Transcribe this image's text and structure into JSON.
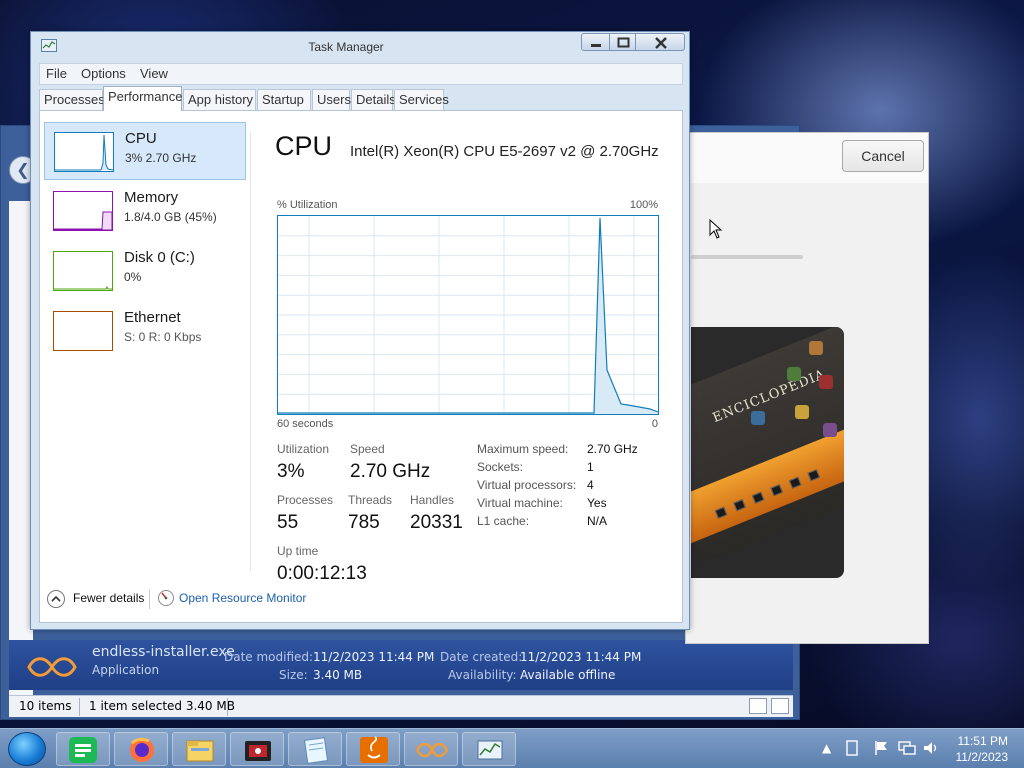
{
  "taskmanager": {
    "title": "Task Manager",
    "menu": [
      "File",
      "Options",
      "View"
    ],
    "tabs": [
      "Processes",
      "Performance",
      "App history",
      "Startup",
      "Users",
      "Details",
      "Services"
    ],
    "active_tab": "Performance",
    "sidebar": [
      {
        "name": "CPU",
        "sub": "3% 2.70 GHz",
        "color": "#117dbb",
        "selected": true
      },
      {
        "name": "Memory",
        "sub": "1.8/4.0 GB (45%)",
        "color": "#8b12ae",
        "selected": false
      },
      {
        "name": "Disk 0 (C:)",
        "sub": "0%",
        "color": "#4da60c",
        "selected": false
      },
      {
        "name": "Ethernet",
        "sub": "S: 0 R: 0 Kbps",
        "color": "#a74f01",
        "selected": false
      }
    ],
    "cpu": {
      "title": "CPU",
      "model": "Intel(R) Xeon(R) CPU E5-2697 v2 @ 2.70GHz",
      "graph_label": "% Utilization",
      "graph_max": "100%",
      "axis_left": "60 seconds",
      "axis_right": "0",
      "stats": {
        "utilization_label": "Utilization",
        "utilization": "3%",
        "speed_label": "Speed",
        "speed": "2.70 GHz",
        "processes_label": "Processes",
        "processes": "55",
        "threads_label": "Threads",
        "threads": "785",
        "handles_label": "Handles",
        "handles": "20331",
        "uptime_label": "Up time",
        "uptime": "0:00:12:13"
      },
      "details": [
        {
          "label": "Maximum speed:",
          "value": "2.70 GHz"
        },
        {
          "label": "Sockets:",
          "value": "1"
        },
        {
          "label": "Virtual processors:",
          "value": "4"
        },
        {
          "label": "Virtual machine:",
          "value": "Yes"
        },
        {
          "label": "L1 cache:",
          "value": "N/A"
        }
      ]
    },
    "footer": {
      "fewer_details": "Fewer details",
      "resource_monitor": "Open Resource Monitor"
    }
  },
  "installer": {
    "cancel_label": "Cancel",
    "hero_text": "ENCICLOPEDIA"
  },
  "explorer": {
    "file_name": "endless-installer.exe",
    "file_type": "Application",
    "date_modified_label": "Date modified:",
    "date_modified": "11/2/2023 11:44 PM",
    "date_created_label": "Date created:",
    "date_created": "11/2/2023 11:44 PM",
    "size_label": "Size:",
    "size": "3.40 MB",
    "availability_label": "Availability:",
    "availability": "Available offline",
    "status_items": "10 items",
    "status_selected": "1 item selected  3.40 MB"
  },
  "taskbar": {
    "apps": [
      "task-view-icon",
      "firefox-icon",
      "file-explorer-icon",
      "media-player-icon",
      "notepad-icon",
      "java-icon",
      "endless-installer-icon",
      "task-manager-icon"
    ],
    "clock_time": "11:51 PM",
    "clock_date": "11/2/2023"
  },
  "colors": {
    "cpu_line": "#117dbb",
    "cpu_fill": "#d8eaf6",
    "grid": "#dbe7f1"
  }
}
